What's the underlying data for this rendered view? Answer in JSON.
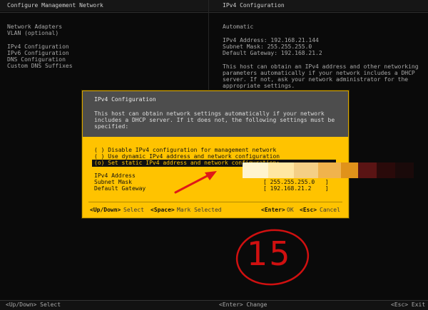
{
  "header": {
    "left_title": "Configure Management Network",
    "right_title": "IPv4 Configuration"
  },
  "menu": {
    "items": [
      "Network Adapters",
      "VLAN (optional)",
      "IPv4 Configuration",
      "IPv6 Configuration",
      "DNS Configuration",
      "Custom DNS Suffixes"
    ]
  },
  "right_panel": {
    "mode": "Automatic",
    "ipv4_address": "IPv4 Address: 192.168.21.144",
    "subnet_mask": "Subnet Mask: 255.255.255.0",
    "default_gateway": "Default Gateway: 192.168.21.2",
    "help_lines": [
      "This host can obtain an IPv4 address and other networking",
      "parameters automatically if your network includes a DHCP",
      "server. If not, ask your network administrator for the",
      "appropriate settings."
    ]
  },
  "dialog": {
    "title": "IPv4 Configuration",
    "desc_lines": [
      "This host can obtain network settings automatically if your network",
      "includes a DHCP server. If it does not, the following settings must be",
      "specified:"
    ],
    "options": [
      "( ) Disable IPv4 configuration for management network",
      "( ) Use dynamic IPv4 address and network configuration",
      "(o) Set static IPv4 address and network configuration:"
    ],
    "fields": {
      "ipv4_label": "IPv4 Address",
      "subnet_label": "Subnet Mask",
      "subnet_value": "[ 255.255.255.0   ]",
      "gateway_label": "Default Gateway",
      "gateway_value": "[ 192.168.21.2    ]"
    },
    "hints": {
      "updown_key": "<Up/Down>",
      "updown_txt": "Select",
      "space_key": "<Space>",
      "space_txt": "Mark Selected",
      "enter_key": "<Enter>",
      "enter_txt": "OK",
      "esc_key": "<Esc>",
      "esc_txt": "Cancel"
    }
  },
  "footer": {
    "left": "<Up/Down> Select",
    "center": "<Enter> Change",
    "right": "<Esc> Exit"
  },
  "annotation": {
    "number": "15",
    "color": "#d01010"
  },
  "colors": {
    "dialog_bg": "#ffc300",
    "dialog_head": "#4d4d4d",
    "background": "#0a0a0a"
  }
}
